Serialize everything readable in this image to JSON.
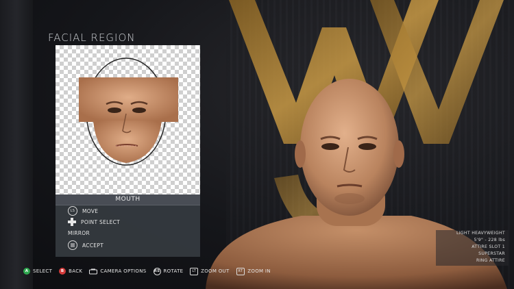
{
  "panel": {
    "title": "FACIAL REGION",
    "region_label": "MOUTH",
    "menu": [
      {
        "button": "LS",
        "label": "MOVE"
      },
      {
        "button": "dpad",
        "label": "POINT SELECT"
      },
      {
        "button": "",
        "label": "MIRROR"
      },
      {
        "button": "menu",
        "label": "ACCEPT"
      }
    ]
  },
  "wrestler_info": {
    "class": "LIGHT HEAVYWEIGHT",
    "stats": "5'9\" - 228 lbs",
    "attire": "ATTIRE SLOT 1",
    "role": "SUPERSTAR",
    "attire_type": "RING ATTIRE"
  },
  "controls": [
    {
      "key": "A",
      "label": "SELECT",
      "color": "#2fa84f"
    },
    {
      "key": "B",
      "label": "BACK",
      "color": "#d23a3a"
    },
    {
      "key": "RS",
      "label": "CAMERA OPTIONS"
    },
    {
      "key": "RS",
      "label": "ROTATE"
    },
    {
      "key": "LT",
      "label": "ZOOM OUT"
    },
    {
      "key": "RT",
      "label": "ZOOM IN"
    }
  ],
  "colors": {
    "accent_gold": "#b8893a",
    "skin": "#c99873",
    "panel_bg": "#373c42"
  }
}
